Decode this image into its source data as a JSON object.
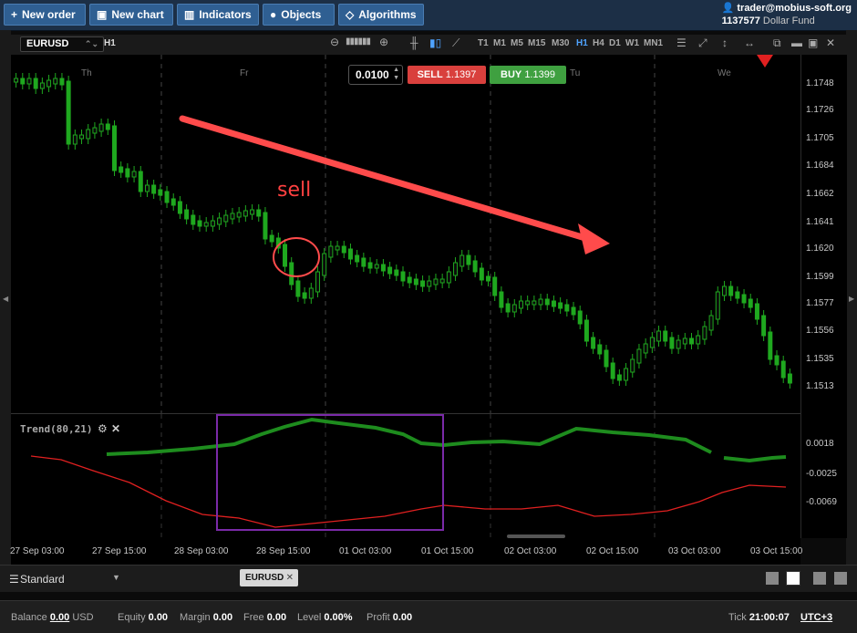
{
  "toolbar": {
    "new_order": "New order",
    "new_chart": "New chart",
    "indicators": "Indicators",
    "objects": "Objects",
    "algorithms": "Algorithms"
  },
  "account": {
    "user": "trader@mobius-soft.org",
    "number": "1137577",
    "fund": "Dollar Fund"
  },
  "chart": {
    "symbol": "EURUSD",
    "timeframe": "H1",
    "timeframes": [
      "T1",
      "M1",
      "M5",
      "M15",
      "M30",
      "H1",
      "H4",
      "D1",
      "W1",
      "MN1"
    ],
    "active_timeframe": "H1",
    "lot": "0.0100",
    "sell_label": "SELL",
    "sell_price": "1.1397",
    "buy_label": "BUY",
    "buy_price": "1.1399",
    "annotation": "sell",
    "day_labels": [
      "Th",
      "Fr",
      "Tu",
      "We"
    ],
    "price_labels": [
      "1.1748",
      "1.1726",
      "1.1705",
      "1.1684",
      "1.1662",
      "1.1641",
      "1.1620",
      "1.1599",
      "1.1577",
      "1.1556",
      "1.1535",
      "1.1513"
    ],
    "time_labels": [
      "27 Sep 03:00",
      "27 Sep 15:00",
      "28 Sep 03:00",
      "28 Sep 15:00",
      "01 Oct 03:00",
      "01 Oct 15:00",
      "02 Oct 03:00",
      "02 Oct 15:00",
      "03 Oct 03:00",
      "03 Oct 15:00"
    ],
    "colors": {
      "up": "#1fa81f",
      "down": "#1fa81f",
      "arrow": "#ff4b4b",
      "box": "#7a2aa8"
    }
  },
  "indicator": {
    "name": "Trend(80,21)",
    "levels": [
      "0.0018",
      "-0.0025",
      "-0.0069"
    ],
    "colors": {
      "trend": "#1e8c1e",
      "signal": "#e02020"
    }
  },
  "workspace": {
    "name": "Standard",
    "tab": "EURUSD"
  },
  "status": {
    "balance_label": "Balance",
    "balance": "0.00",
    "currency": "USD",
    "equity_label": "Equity",
    "equity": "0.00",
    "margin_label": "Margin",
    "margin": "0.00",
    "free_label": "Free",
    "free": "0.00",
    "level_label": "Level",
    "level": "0.00%",
    "profit_label": "Profit",
    "profit": "0.00",
    "tick_label": "Tick",
    "tick_time": "21:00:07",
    "timezone": "UTC+3"
  }
}
